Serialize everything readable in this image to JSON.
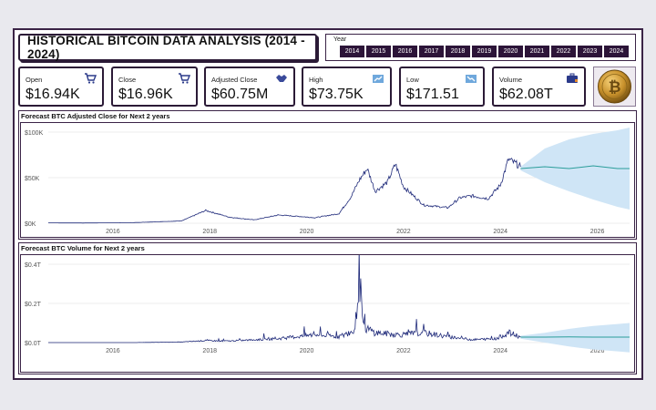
{
  "dashboard": {
    "title": "HISTORICAL BITCOIN DATA ANALYSIS (2014 - 2024)"
  },
  "year_slicer": {
    "label": "Year",
    "years": [
      "2014",
      "2015",
      "2016",
      "2017",
      "2018",
      "2019",
      "2020",
      "2021",
      "2022",
      "2023",
      "2024"
    ]
  },
  "kpis": [
    {
      "label": "Open",
      "value": "$16.94K",
      "icon": "cart-icon"
    },
    {
      "label": "Close",
      "value": "$16.96K",
      "icon": "cart-icon"
    },
    {
      "label": "Adjusted Close",
      "value": "$60.75M",
      "icon": "handshake-icon"
    },
    {
      "label": "High",
      "value": "$73.75K",
      "icon": "trend-up-icon"
    },
    {
      "label": "Low",
      "value": "$171.51",
      "icon": "trend-down-icon"
    },
    {
      "label": "Volume",
      "value": "$62.08T",
      "icon": "briefcase-icon"
    }
  ],
  "logo": {
    "name": "bitcoin-coin-icon"
  },
  "colors": {
    "accent": "#2c1438",
    "series_line": "#1f2a7a",
    "forecast_line": "#2a9d9a",
    "forecast_band": "#cfe5f6"
  },
  "chart_data": [
    {
      "type": "line",
      "title": "Forecast BTC Adjusted Close for Next 2 years",
      "x_ticks": [
        "2016",
        "2018",
        "2020",
        "2022",
        "2024",
        "2026"
      ],
      "y_ticks": [
        "$0K",
        "$50K",
        "$100K"
      ],
      "ylim": [
        0,
        100000
      ],
      "xlim": [
        "2014-09",
        "2026-09"
      ],
      "series": [
        {
          "x": [
            "2014-09",
            "2015-06",
            "2016-06",
            "2017-06",
            "2017-12",
            "2018-06",
            "2018-12",
            "2019-06",
            "2019-12",
            "2020-03",
            "2020-09",
            "2020-12",
            "2021-02",
            "2021-04",
            "2021-06",
            "2021-09",
            "2021-11",
            "2022-01",
            "2022-06",
            "2022-12",
            "2023-03",
            "2023-06",
            "2023-10",
            "2024-01",
            "2024-03",
            "2024-05",
            "2024-06"
          ],
          "values": [
            400,
            250,
            650,
            2500,
            14000,
            6500,
            3700,
            9000,
            7200,
            6000,
            10500,
            29000,
            47000,
            60000,
            35000,
            45000,
            65000,
            40000,
            20000,
            17000,
            28000,
            30000,
            27000,
            42000,
            70000,
            65000,
            62000
          ]
        }
      ],
      "forecast": {
        "x": [
          "2024-06",
          "2024-12",
          "2025-06",
          "2025-12",
          "2026-06",
          "2026-09"
        ],
        "values": [
          60000,
          62000,
          60000,
          63000,
          60000,
          60000
        ],
        "upper": [
          62000,
          82000,
          92000,
          98000,
          102000,
          105000
        ],
        "lower": [
          58000,
          45000,
          35000,
          26000,
          18000,
          15000
        ]
      }
    },
    {
      "type": "line",
      "title": "Forecast BTC Volume for Next 2 years",
      "x_ticks": [
        "2016",
        "2018",
        "2020",
        "2022",
        "2024",
        "2026"
      ],
      "y_ticks": [
        "$0.0T",
        "$0.2T",
        "$0.4T"
      ],
      "ylim": [
        0,
        0.4
      ],
      "xlim": [
        "2014-09",
        "2026-09"
      ],
      "series": [
        {
          "x": [
            "2014-09",
            "2016-06",
            "2017-06",
            "2017-12",
            "2018-06",
            "2019-06",
            "2020-03",
            "2020-09",
            "2021-01",
            "2021-02",
            "2021-03",
            "2021-06",
            "2021-12",
            "2022-06",
            "2022-12",
            "2023-06",
            "2023-12",
            "2024-03",
            "2024-06"
          ],
          "values": [
            0.0,
            0.0,
            0.003,
            0.01,
            0.008,
            0.02,
            0.04,
            0.03,
            0.06,
            0.36,
            0.08,
            0.05,
            0.04,
            0.05,
            0.03,
            0.015,
            0.02,
            0.05,
            0.03
          ]
        }
      ],
      "forecast": {
        "x": [
          "2024-06",
          "2024-12",
          "2025-06",
          "2025-12",
          "2026-06",
          "2026-09"
        ],
        "values": [
          0.028,
          0.028,
          0.029,
          0.028,
          0.028,
          0.028
        ],
        "upper": [
          0.035,
          0.05,
          0.07,
          0.085,
          0.095,
          0.1
        ],
        "lower": [
          0.02,
          0.0,
          -0.02,
          -0.035,
          -0.045,
          -0.05
        ]
      }
    }
  ]
}
